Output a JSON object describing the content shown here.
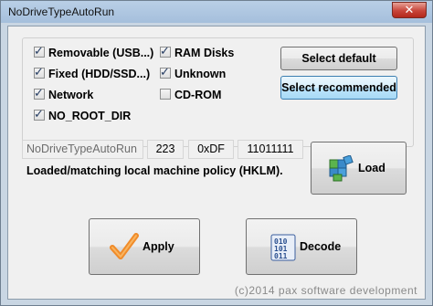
{
  "window": {
    "title": "NoDriveTypeAutoRun",
    "close_label": "✕"
  },
  "checkboxes": {
    "removable": {
      "label": "Removable (USB...)",
      "checked": true
    },
    "fixed": {
      "label": "Fixed (HDD/SSD...)",
      "checked": true
    },
    "network": {
      "label": "Network",
      "checked": true
    },
    "no_root_dir": {
      "label": "NO_ROOT_DIR",
      "checked": true
    },
    "ram_disks": {
      "label": "RAM Disks",
      "checked": true
    },
    "unknown": {
      "label": "Unknown",
      "checked": true
    },
    "cd_rom": {
      "label": "CD-ROM",
      "checked": false
    }
  },
  "buttons": {
    "select_default": "Select default",
    "select_recommended": "Select recommended",
    "load": "Load",
    "apply": "Apply",
    "decode": "Decode"
  },
  "value_row": {
    "name": "NoDriveTypeAutoRun",
    "decimal": "223",
    "hex": "0xDF",
    "binary": "11011111"
  },
  "status_text": "Loaded/matching local machine policy (HKLM).",
  "footer": {
    "copyright": "(c)2014 pax software development"
  },
  "icons": {
    "load": "registry-cubes-icon",
    "apply": "checkmark-icon",
    "decode": "binary-decode-icon"
  }
}
